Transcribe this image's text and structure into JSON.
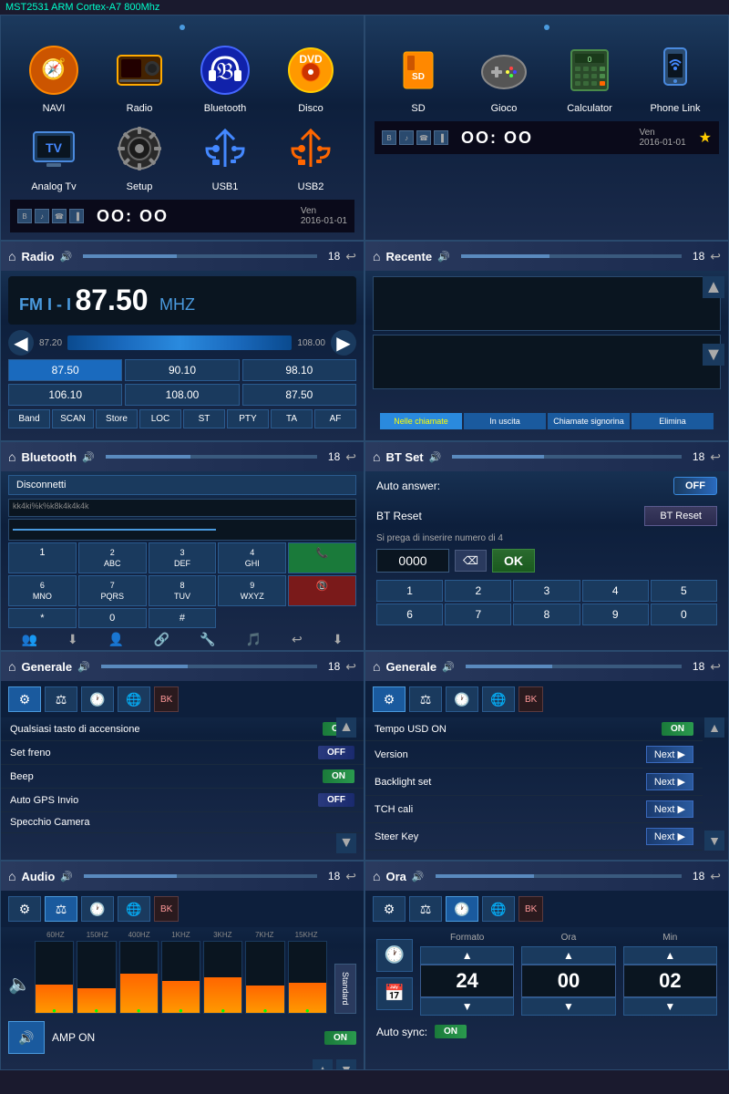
{
  "header": {
    "title": "MST2531 ARM Cortex-A7 800Mhz"
  },
  "panels": {
    "left_app_launcher": {
      "apps": [
        {
          "label": "NAVI",
          "icon": "🧭"
        },
        {
          "label": "Radio",
          "icon": "📻"
        },
        {
          "label": "Bluetooth",
          "icon": "🎧"
        },
        {
          "label": "Disco",
          "icon": "💿"
        },
        {
          "label": "Analog Tv",
          "icon": "📺"
        },
        {
          "label": "Setup",
          "icon": "⚙️"
        },
        {
          "label": "USB1",
          "icon": "🔌"
        },
        {
          "label": "USB2",
          "icon": "🔌"
        }
      ],
      "status_bar": {
        "time": "OO: OO",
        "day": "Ven",
        "date": "2016-01-01"
      }
    },
    "right_app_launcher": {
      "apps": [
        {
          "label": "SD",
          "icon": "💾"
        },
        {
          "label": "Gioco",
          "icon": "🎮"
        },
        {
          "label": "Calculator",
          "icon": "🧮"
        },
        {
          "label": "Phone Link",
          "icon": "📱"
        }
      ],
      "status_bar": {
        "time": "OO: OO",
        "day": "Ven",
        "date": "2016-01-01"
      }
    },
    "radio": {
      "title": "Radio",
      "band": "FM I - I",
      "frequency": "87.50",
      "unit": "MHZ",
      "range_min": "87.20",
      "range_max": "108.00",
      "presets": [
        "87.50",
        "90.10",
        "98.10",
        "106.10",
        "108.00",
        "87.50"
      ],
      "controls": [
        "Band",
        "SCAN",
        "Store",
        "LOC",
        "ST",
        "PTY",
        "TA",
        "AF"
      ],
      "volume": "18"
    },
    "recente": {
      "title": "Recente",
      "tabs": [
        "Nelle chiamate",
        "In uscita",
        "Chiamate signorina",
        "Elimina"
      ],
      "volume": "18"
    },
    "bluetooth": {
      "title": "Bluetooth",
      "disconnetti": "Disconnetti",
      "device_name": "kk4ki%k%k8k4k4k4k",
      "keypad": [
        "1",
        "2\nABC",
        "3\nDEF",
        "4\nGHI",
        "✓",
        "6\nMNO",
        "7\nPQRS",
        "8\nTUV",
        "9\nWXYZ",
        "0",
        "*",
        "#",
        "📞",
        "📵"
      ],
      "bottom_icons": [
        "📞",
        "⬇",
        "👤",
        "🔗",
        "🔧",
        "🎵",
        "↩",
        "⬇"
      ],
      "volume": "18"
    },
    "bt_set": {
      "title": "BT Set",
      "auto_answer_label": "Auto answer:",
      "auto_answer_value": "OFF",
      "bt_reset_label": "BT Reset",
      "bt_reset_btn": "BT Reset",
      "pin_hint": "Si prega di inserire numero di 4",
      "pin_value": "0000",
      "numpad": [
        "1",
        "2",
        "3",
        "4",
        "5",
        "6",
        "7",
        "8",
        "9",
        "0"
      ],
      "volume": "18"
    },
    "generale_left": {
      "title": "Generale",
      "volume": "18",
      "settings": [
        {
          "label": "Qualsiasi tasto di accensione",
          "value": "ON"
        },
        {
          "label": "Set freno",
          "value": "OFF"
        },
        {
          "label": "Beep",
          "value": "ON"
        },
        {
          "label": "Auto GPS Invio",
          "value": "OFF"
        },
        {
          "label": "Specchio Camera",
          "value": ""
        }
      ]
    },
    "generale_right": {
      "title": "Generale",
      "volume": "18",
      "settings": [
        {
          "label": "Tempo USD ON",
          "value": "ON"
        },
        {
          "label": "Version",
          "value": "Next"
        },
        {
          "label": "Backlight set",
          "value": "Next"
        },
        {
          "label": "TCH cali",
          "value": "Next"
        },
        {
          "label": "Steer Key",
          "value": "Next"
        }
      ]
    },
    "audio": {
      "title": "Audio",
      "volume": "18",
      "eq_labels": [
        "60HZ",
        "150HZ",
        "400HZ",
        "1KHZ",
        "3KHZ",
        "7KHZ",
        "15KHZ"
      ],
      "eq_heights": [
        40,
        35,
        55,
        45,
        50,
        38,
        42
      ],
      "standard_btn": "Standard",
      "amp_on_label": "AMP ON",
      "amp_on_value": "ON"
    },
    "ora": {
      "title": "Ora",
      "volume": "18",
      "formato_label": "Formato",
      "ora_label": "Ora",
      "min_label": "Min",
      "formato_value": "24",
      "ora_value": "00",
      "min_value": "02",
      "auto_sync_label": "Auto sync:",
      "auto_sync_value": "ON"
    }
  }
}
